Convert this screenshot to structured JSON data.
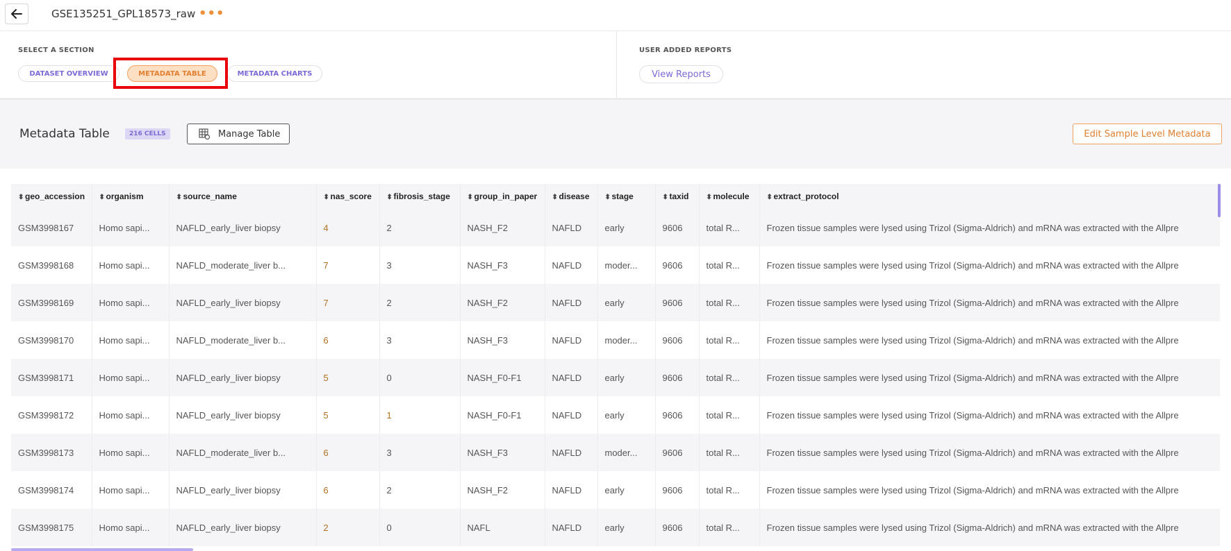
{
  "header": {
    "title": "GSE135251_GPL18573_raw",
    "more_icon": "more-horizontal-icon",
    "accent_color": "#f0903a"
  },
  "sections": {
    "heading": "SELECT A SECTION",
    "tabs": [
      {
        "label": "DATASET OVERVIEW",
        "active": false
      },
      {
        "label": "METADATA TABLE",
        "active": true
      },
      {
        "label": "METADATA CHARTS",
        "active": false
      }
    ],
    "reports_heading": "USER ADDED REPORTS",
    "view_reports": "View Reports"
  },
  "metadata": {
    "title": "Metadata Table",
    "cells_badge": "216 CELLS",
    "manage_button": "Manage Table",
    "edit_button": "Edit Sample Level Metadata"
  },
  "table": {
    "columns": [
      "geo_accession",
      "organism",
      "source_name",
      "nas_score",
      "fibrosis_stage",
      "group_in_paper",
      "disease",
      "stage",
      "taxid",
      "molecule",
      "extract_protocol"
    ],
    "rows": [
      [
        "GSM3998167",
        "Homo sapi...",
        "NAFLD_early_liver biopsy",
        "4",
        "2",
        "NASH_F2",
        "NAFLD",
        "early",
        "9606",
        "total R...",
        "Frozen tissue samples were lysed using Trizol (Sigma-Aldrich) and mRNA was extracted with the Allpre"
      ],
      [
        "GSM3998168",
        "Homo sapi...",
        "NAFLD_moderate_liver b...",
        "7",
        "3",
        "NASH_F3",
        "NAFLD",
        "moder...",
        "9606",
        "total R...",
        "Frozen tissue samples were lysed using Trizol (Sigma-Aldrich) and mRNA was extracted with the Allpre"
      ],
      [
        "GSM3998169",
        "Homo sapi...",
        "NAFLD_early_liver biopsy",
        "7",
        "2",
        "NASH_F2",
        "NAFLD",
        "early",
        "9606",
        "total R...",
        "Frozen tissue samples were lysed using Trizol (Sigma-Aldrich) and mRNA was extracted with the Allpre"
      ],
      [
        "GSM3998170",
        "Homo sapi...",
        "NAFLD_moderate_liver b...",
        "6",
        "3",
        "NASH_F3",
        "NAFLD",
        "moder...",
        "9606",
        "total R...",
        "Frozen tissue samples were lysed using Trizol (Sigma-Aldrich) and mRNA was extracted with the Allpre"
      ],
      [
        "GSM3998171",
        "Homo sapi...",
        "NAFLD_early_liver biopsy",
        "5",
        "0",
        "NASH_F0-F1",
        "NAFLD",
        "early",
        "9606",
        "total R...",
        "Frozen tissue samples were lysed using Trizol (Sigma-Aldrich) and mRNA was extracted with the Allpre"
      ],
      [
        "GSM3998172",
        "Homo sapi...",
        "NAFLD_early_liver biopsy",
        "5",
        "1",
        "NASH_F0-F1",
        "NAFLD",
        "early",
        "9606",
        "total R...",
        "Frozen tissue samples were lysed using Trizol (Sigma-Aldrich) and mRNA was extracted with the Allpre"
      ],
      [
        "GSM3998173",
        "Homo sapi...",
        "NAFLD_moderate_liver b...",
        "6",
        "3",
        "NASH_F3",
        "NAFLD",
        "moder...",
        "9606",
        "total R...",
        "Frozen tissue samples were lysed using Trizol (Sigma-Aldrich) and mRNA was extracted with the Allpre"
      ],
      [
        "GSM3998174",
        "Homo sapi...",
        "NAFLD_early_liver biopsy",
        "6",
        "2",
        "NASH_F2",
        "NAFLD",
        "early",
        "9606",
        "total R...",
        "Frozen tissue samples were lysed using Trizol (Sigma-Aldrich) and mRNA was extracted with the Allpre"
      ],
      [
        "GSM3998175",
        "Homo sapi...",
        "NAFLD_early_liver biopsy",
        "2",
        "0",
        "NAFL",
        "NAFLD",
        "early",
        "9606",
        "total R...",
        "Frozen tissue samples were lysed using Trizol (Sigma-Aldrich) and mRNA was extracted with the Allpre"
      ]
    ]
  },
  "colors": {
    "accent_orange": "#f0903a",
    "accent_purple": "#7b6bd6",
    "highlight_red": "#e8000a"
  }
}
